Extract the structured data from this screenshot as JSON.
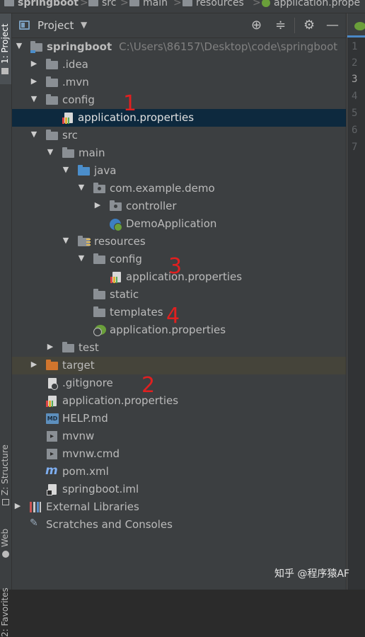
{
  "breadcrumb": [
    "springboot",
    "src",
    "main",
    "resources",
    "application.prope"
  ],
  "tool_window": {
    "title": "Project",
    "dropdown": "▼",
    "actions": [
      "locate",
      "collapse-all",
      "settings",
      "hide"
    ]
  },
  "side_tabs": {
    "project": "1: Project",
    "structure": "Z: Structure",
    "web": "Web",
    "favorites": "2: Favorites"
  },
  "tree": {
    "root": {
      "name": "springboot",
      "path": "C:\\Users\\86157\\Desktop\\code\\springboot"
    },
    "idea": ".idea",
    "mvn": ".mvn",
    "config": "config",
    "config_props": "application.properties",
    "src": "src",
    "main": "main",
    "java": "java",
    "package": "com.example.demo",
    "controller": "controller",
    "demo_app": "DemoApplication",
    "resources": "resources",
    "res_config": "config",
    "res_config_props": "application.properties",
    "static": "static",
    "templates": "templates",
    "res_props": "application.properties",
    "test": "test",
    "target": "target",
    "gitignore": ".gitignore",
    "root_props": "application.properties",
    "help": "HELP.md",
    "mvnw": "mvnw",
    "mvnw_cmd": "mvnw.cmd",
    "pom": "pom.xml",
    "iml": "springboot.iml",
    "ext_libs": "External Libraries",
    "scratches": "Scratches and Consoles"
  },
  "annotations": [
    "1",
    "2",
    "3",
    "4"
  ],
  "line_numbers": [
    "1",
    "2",
    "3",
    "4",
    "5",
    "6",
    "7"
  ],
  "watermark": "知乎 @程序猿AF",
  "md_badge": "MD",
  "cmd_glyph": "▸",
  "m_glyph": "m"
}
